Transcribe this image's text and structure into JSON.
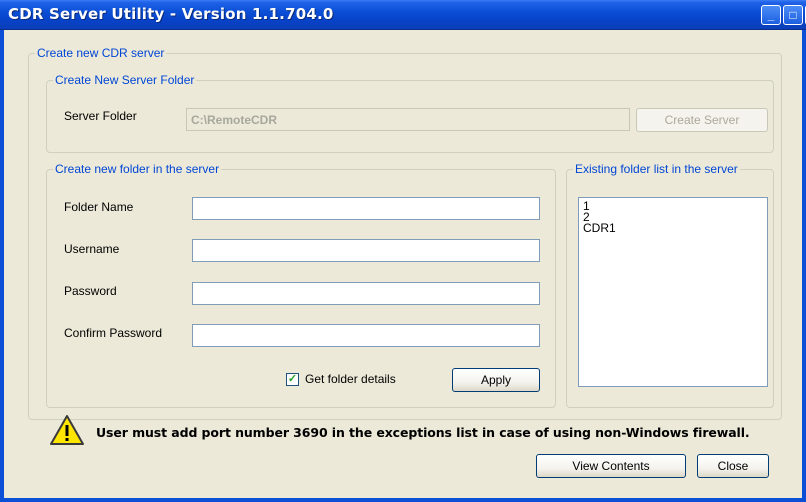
{
  "window": {
    "title": "CDR Server Utility - Version 1.1.704.0"
  },
  "create_cdr_server": {
    "legend": "Create new CDR server",
    "server_folder_group": {
      "legend": "Create New Server Folder",
      "label": "Server Folder",
      "value": "C:\\RemoteCDR",
      "create_button": "Create Server"
    },
    "new_folder_group": {
      "legend": "Create new folder in the server",
      "folder_name_label": "Folder Name",
      "username_label": "Username",
      "password_label": "Password",
      "confirm_password_label": "Confirm Password",
      "folder_name_value": "",
      "username_value": "",
      "password_value": "",
      "confirm_password_value": "",
      "get_details_label": "Get folder details",
      "get_details_checked": true,
      "apply_button": "Apply"
    },
    "existing_group": {
      "legend": "Existing folder list in the server",
      "items": [
        "1",
        "2",
        "CDR1"
      ]
    }
  },
  "warning": {
    "icon": "warning-triangle-icon",
    "text": "User must add port number 3690 in the exceptions list in case of using non-Windows firewall."
  },
  "footer": {
    "view_contents_button": "View Contents",
    "close_button": "Close"
  },
  "colors": {
    "title_bar": "#0a4fd6",
    "group_legend": "#0046d5",
    "window_bg": "#ece9d8"
  }
}
